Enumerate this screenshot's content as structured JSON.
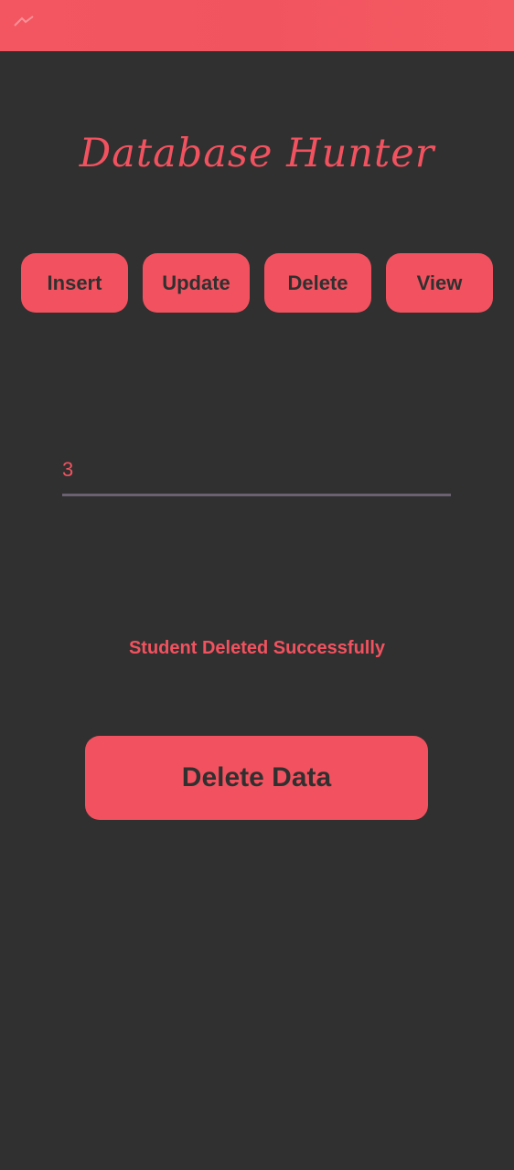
{
  "app": {
    "title": "Database Hunter"
  },
  "nav": {
    "insert_label": "Insert",
    "update_label": "Update",
    "delete_label": "Delete",
    "view_label": "View"
  },
  "form": {
    "id_value": "3"
  },
  "message": {
    "status_text": "Student Deleted Successfully"
  },
  "actions": {
    "primary_label": "Delete Data"
  },
  "colors": {
    "background": "#303030",
    "accent": "#f2525f",
    "input_underline": "#6b6171"
  },
  "icons": {
    "status_mark": "status-bar-mark-icon"
  }
}
